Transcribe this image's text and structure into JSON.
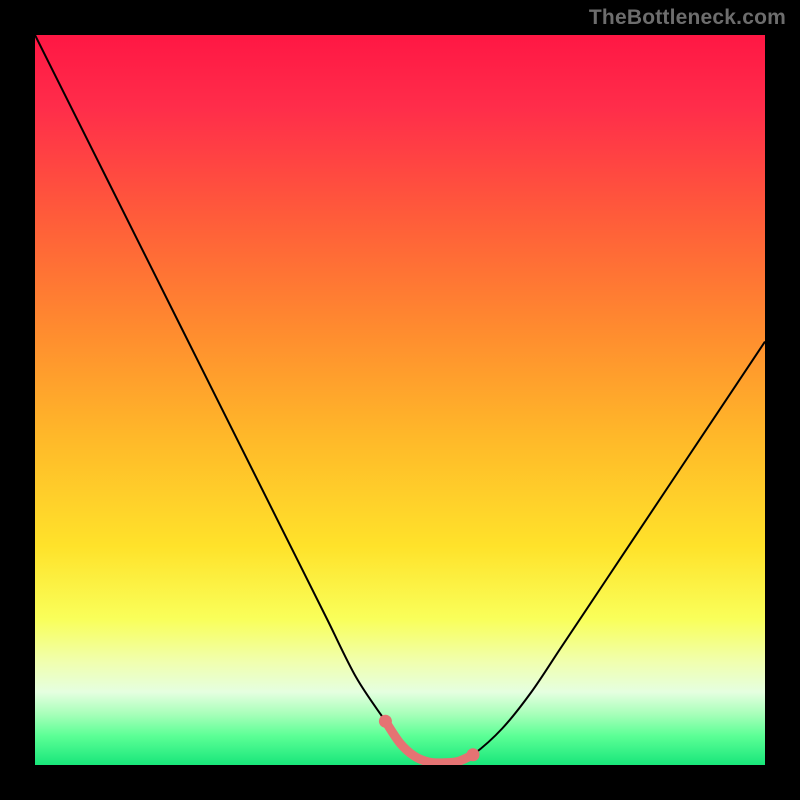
{
  "watermark": "TheBottleneck.com",
  "colors": {
    "black": "#000000",
    "curve": "#000000",
    "overlay": "#e57373",
    "gradient_stops": [
      {
        "offset": 0.0,
        "color": "#ff1744"
      },
      {
        "offset": 0.1,
        "color": "#ff2d4a"
      },
      {
        "offset": 0.25,
        "color": "#ff5c3a"
      },
      {
        "offset": 0.4,
        "color": "#ff8a2f"
      },
      {
        "offset": 0.55,
        "color": "#ffb829"
      },
      {
        "offset": 0.7,
        "color": "#ffe22a"
      },
      {
        "offset": 0.8,
        "color": "#f9ff5a"
      },
      {
        "offset": 0.86,
        "color": "#f0ffb0"
      },
      {
        "offset": 0.9,
        "color": "#e5ffe0"
      },
      {
        "offset": 0.93,
        "color": "#a8ffba"
      },
      {
        "offset": 0.96,
        "color": "#5cff96"
      },
      {
        "offset": 1.0,
        "color": "#18e67a"
      }
    ]
  },
  "chart_data": {
    "type": "line",
    "title": "",
    "xlabel": "",
    "ylabel": "",
    "xlim": [
      0,
      100
    ],
    "ylim": [
      0,
      100
    ],
    "series": [
      {
        "name": "curve",
        "x": [
          0,
          4,
          8,
          12,
          16,
          20,
          24,
          28,
          32,
          36,
          40,
          44,
          48,
          50,
          52,
          54,
          56,
          58,
          60,
          64,
          68,
          72,
          76,
          80,
          84,
          88,
          92,
          96,
          100
        ],
        "y": [
          100,
          92,
          84,
          76,
          68,
          60,
          52,
          44,
          36,
          28,
          20,
          12,
          6,
          3,
          1.2,
          0.4,
          0.3,
          0.5,
          1.4,
          5,
          10,
          16,
          22,
          28,
          34,
          40,
          46,
          52,
          58
        ]
      }
    ],
    "highlight_segment": {
      "x": [
        48,
        50,
        52,
        54,
        56,
        58,
        60
      ],
      "y": [
        6,
        3,
        1.2,
        0.4,
        0.3,
        0.5,
        1.4
      ]
    }
  }
}
